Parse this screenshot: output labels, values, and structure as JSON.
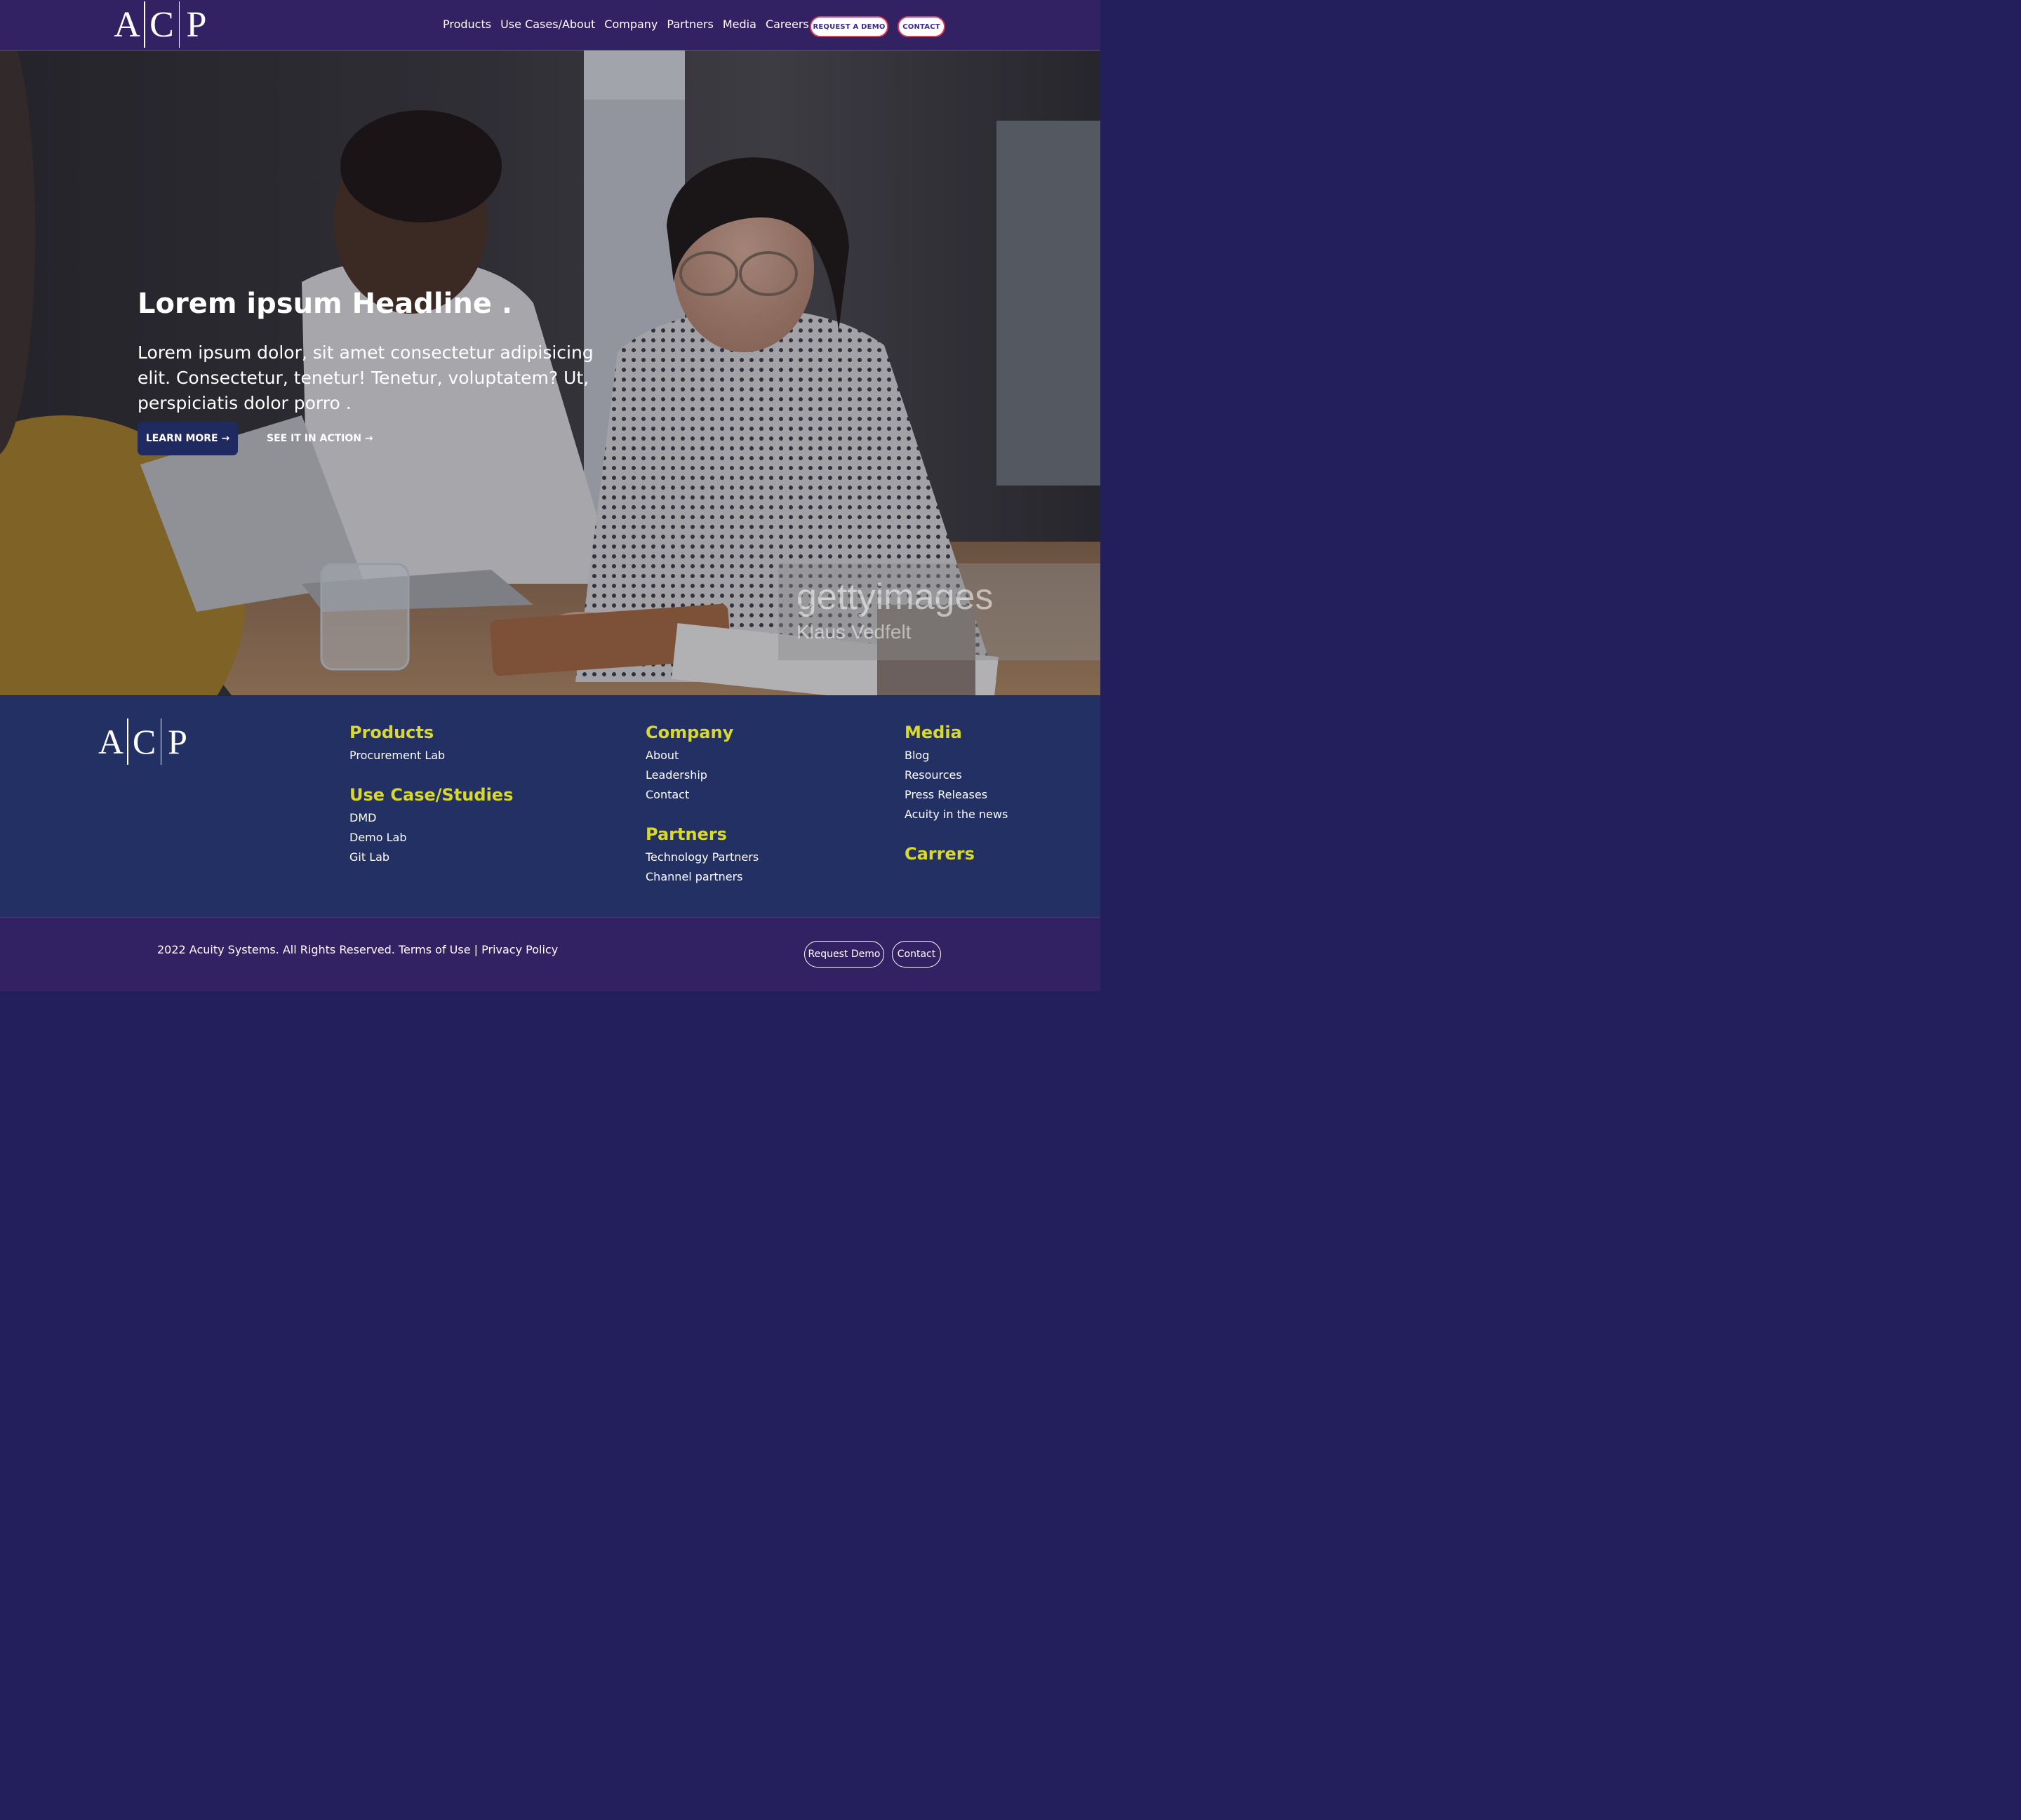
{
  "header": {
    "logo_letters": [
      "A",
      "C",
      "P"
    ],
    "nav": [
      "Products",
      "Use Cases/About",
      "Company",
      "Partners",
      "Media",
      "Careers"
    ],
    "request_demo": "REQUEST A DEMO",
    "contact": "CONTACT"
  },
  "hero": {
    "headline": "Lorem ipsum Headline .",
    "body": "Lorem ipsum dolor, sit amet consectetur adipisicing elit. Consectetur, tenetur! Tenetur, voluptatem? Ut, perspiciatis dolor porro .",
    "learn_more": "LEARN MORE →",
    "see_in_action": "SEE IT IN ACTION →",
    "watermark_brand": "gettyimages",
    "watermark_credit": "Klaus Vedfelt"
  },
  "footer": {
    "logo_letters": [
      "A",
      "C",
      "P"
    ],
    "products": {
      "heading": "Products",
      "links": [
        "Procurement Lab"
      ]
    },
    "use_cases": {
      "heading": "Use Case/Studies",
      "links": [
        "DMD",
        "Demo Lab",
        "Git Lab"
      ]
    },
    "company": {
      "heading": "Company",
      "links": [
        "About",
        "Leadership",
        "Contact"
      ]
    },
    "partners": {
      "heading": "Partners",
      "links": [
        "Technology Partners",
        "Channel partners"
      ]
    },
    "media": {
      "heading": "Media",
      "links": [
        "Blog",
        "Resources",
        "Press Releases",
        "Acuity in the news"
      ]
    },
    "careers": {
      "heading": "Carrers"
    }
  },
  "bottom": {
    "copyright": "2022 Acuity Systems. All Rights Reserved. Terms of Use | Privacy Policy",
    "request_demo": "Request Demo",
    "contact": "Contact"
  },
  "colors": {
    "header_bg": "#322163",
    "footer_bg": "#223063",
    "heading_accent": "#d8d92a",
    "primary_button": "#1f2a60",
    "pill_border": "#e33a5a"
  }
}
